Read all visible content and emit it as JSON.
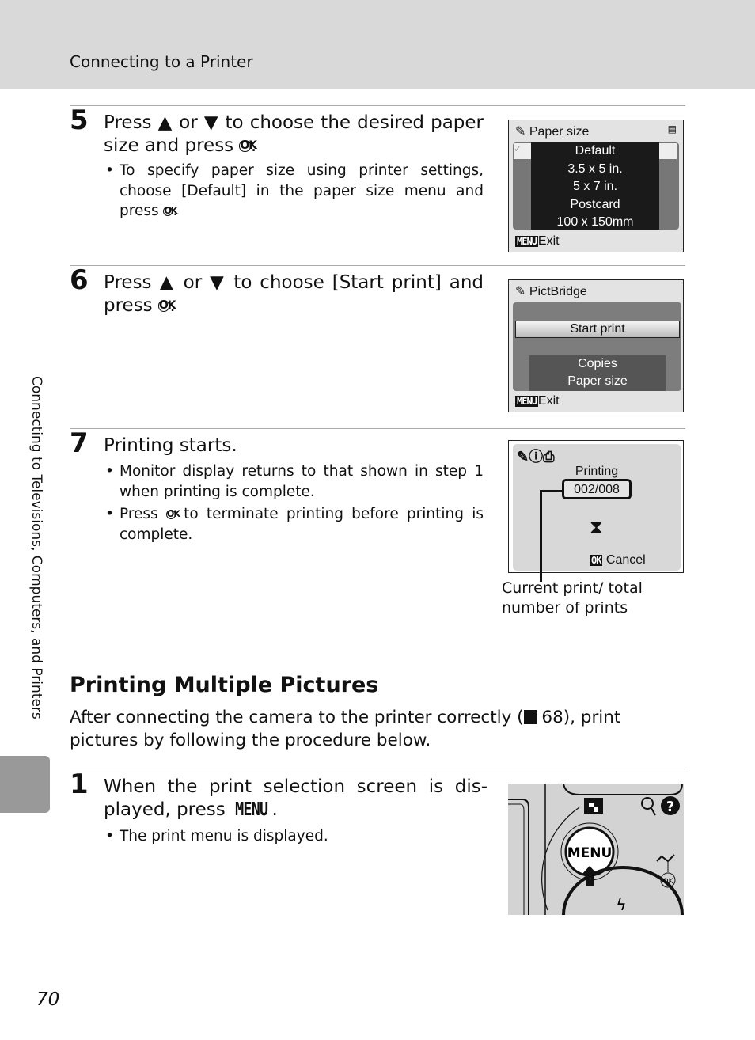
{
  "header": {
    "title": "Connecting to a Printer"
  },
  "side_tab": {
    "label": "Connecting to Televisions, Computers, and Printers"
  },
  "steps": [
    {
      "number": "5",
      "text_a": "Press ▲ or ▼ to choose the desired paper size and press ",
      "bullets": [
        "To specify paper size using printer settings, choose [Default] in the paper size menu and press "
      ]
    },
    {
      "number": "6",
      "text_a": "Press ▲ or ▼ to choose [Start print] and press "
    },
    {
      "number": "7",
      "text_a": "Printing starts.",
      "bullets": [
        "Monitor display returns to that shown in step 1 when printing is complete.",
        "Press ",
        "to terminate printing before printing is complete."
      ]
    }
  ],
  "ok_glyph": "OK",
  "screen_paper": {
    "title": "Paper size",
    "items": [
      "Default",
      "3.5 x 5 in.",
      "5 x 7 in.",
      "Postcard",
      "100 x 150mm"
    ],
    "menu": "MENU",
    "exit": "Exit"
  },
  "screen_pictbridge": {
    "title": "PictBridge",
    "selected": "Start print",
    "items": [
      "Copies",
      "Paper size"
    ],
    "menu": "MENU",
    "exit": "Exit"
  },
  "screen_printing": {
    "label": "Printing",
    "counter": "002/008",
    "ok": "OK",
    "cancel": "Cancel",
    "callout": "Current print/ total number of prints"
  },
  "section": {
    "title": "Printing Multiple Pictures",
    "intro_a": "After connecting the camera to the printer correctly (",
    "intro_ref": "68), print pictures by following the procedure below."
  },
  "step1": {
    "number": "1",
    "text": "When the print selection screen is dis-played, press ",
    "menu": "MENU",
    "bullet": "The print menu is displayed.",
    "button_label": "MENU",
    "ok_label": "OK"
  },
  "page_number": "70"
}
